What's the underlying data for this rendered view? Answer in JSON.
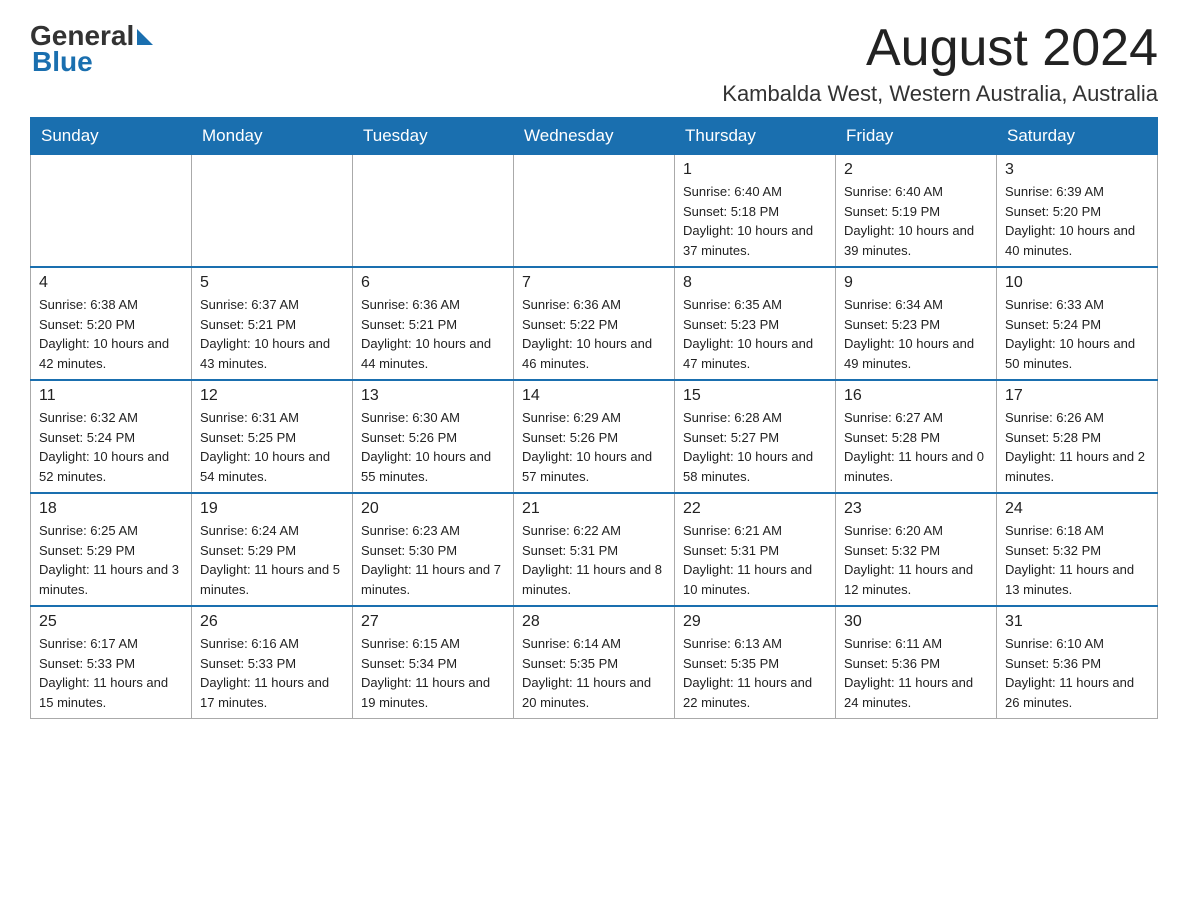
{
  "logo": {
    "general": "General",
    "triangle": "▶",
    "blue": "Blue"
  },
  "title": "August 2024",
  "subtitle": "Kambalda West, Western Australia, Australia",
  "weekdays": [
    "Sunday",
    "Monday",
    "Tuesday",
    "Wednesday",
    "Thursday",
    "Friday",
    "Saturday"
  ],
  "weeks": [
    [
      {
        "day": "",
        "info": ""
      },
      {
        "day": "",
        "info": ""
      },
      {
        "day": "",
        "info": ""
      },
      {
        "day": "",
        "info": ""
      },
      {
        "day": "1",
        "info": "Sunrise: 6:40 AM\nSunset: 5:18 PM\nDaylight: 10 hours and 37 minutes."
      },
      {
        "day": "2",
        "info": "Sunrise: 6:40 AM\nSunset: 5:19 PM\nDaylight: 10 hours and 39 minutes."
      },
      {
        "day": "3",
        "info": "Sunrise: 6:39 AM\nSunset: 5:20 PM\nDaylight: 10 hours and 40 minutes."
      }
    ],
    [
      {
        "day": "4",
        "info": "Sunrise: 6:38 AM\nSunset: 5:20 PM\nDaylight: 10 hours and 42 minutes."
      },
      {
        "day": "5",
        "info": "Sunrise: 6:37 AM\nSunset: 5:21 PM\nDaylight: 10 hours and 43 minutes."
      },
      {
        "day": "6",
        "info": "Sunrise: 6:36 AM\nSunset: 5:21 PM\nDaylight: 10 hours and 44 minutes."
      },
      {
        "day": "7",
        "info": "Sunrise: 6:36 AM\nSunset: 5:22 PM\nDaylight: 10 hours and 46 minutes."
      },
      {
        "day": "8",
        "info": "Sunrise: 6:35 AM\nSunset: 5:23 PM\nDaylight: 10 hours and 47 minutes."
      },
      {
        "day": "9",
        "info": "Sunrise: 6:34 AM\nSunset: 5:23 PM\nDaylight: 10 hours and 49 minutes."
      },
      {
        "day": "10",
        "info": "Sunrise: 6:33 AM\nSunset: 5:24 PM\nDaylight: 10 hours and 50 minutes."
      }
    ],
    [
      {
        "day": "11",
        "info": "Sunrise: 6:32 AM\nSunset: 5:24 PM\nDaylight: 10 hours and 52 minutes."
      },
      {
        "day": "12",
        "info": "Sunrise: 6:31 AM\nSunset: 5:25 PM\nDaylight: 10 hours and 54 minutes."
      },
      {
        "day": "13",
        "info": "Sunrise: 6:30 AM\nSunset: 5:26 PM\nDaylight: 10 hours and 55 minutes."
      },
      {
        "day": "14",
        "info": "Sunrise: 6:29 AM\nSunset: 5:26 PM\nDaylight: 10 hours and 57 minutes."
      },
      {
        "day": "15",
        "info": "Sunrise: 6:28 AM\nSunset: 5:27 PM\nDaylight: 10 hours and 58 minutes."
      },
      {
        "day": "16",
        "info": "Sunrise: 6:27 AM\nSunset: 5:28 PM\nDaylight: 11 hours and 0 minutes."
      },
      {
        "day": "17",
        "info": "Sunrise: 6:26 AM\nSunset: 5:28 PM\nDaylight: 11 hours and 2 minutes."
      }
    ],
    [
      {
        "day": "18",
        "info": "Sunrise: 6:25 AM\nSunset: 5:29 PM\nDaylight: 11 hours and 3 minutes."
      },
      {
        "day": "19",
        "info": "Sunrise: 6:24 AM\nSunset: 5:29 PM\nDaylight: 11 hours and 5 minutes."
      },
      {
        "day": "20",
        "info": "Sunrise: 6:23 AM\nSunset: 5:30 PM\nDaylight: 11 hours and 7 minutes."
      },
      {
        "day": "21",
        "info": "Sunrise: 6:22 AM\nSunset: 5:31 PM\nDaylight: 11 hours and 8 minutes."
      },
      {
        "day": "22",
        "info": "Sunrise: 6:21 AM\nSunset: 5:31 PM\nDaylight: 11 hours and 10 minutes."
      },
      {
        "day": "23",
        "info": "Sunrise: 6:20 AM\nSunset: 5:32 PM\nDaylight: 11 hours and 12 minutes."
      },
      {
        "day": "24",
        "info": "Sunrise: 6:18 AM\nSunset: 5:32 PM\nDaylight: 11 hours and 13 minutes."
      }
    ],
    [
      {
        "day": "25",
        "info": "Sunrise: 6:17 AM\nSunset: 5:33 PM\nDaylight: 11 hours and 15 minutes."
      },
      {
        "day": "26",
        "info": "Sunrise: 6:16 AM\nSunset: 5:33 PM\nDaylight: 11 hours and 17 minutes."
      },
      {
        "day": "27",
        "info": "Sunrise: 6:15 AM\nSunset: 5:34 PM\nDaylight: 11 hours and 19 minutes."
      },
      {
        "day": "28",
        "info": "Sunrise: 6:14 AM\nSunset: 5:35 PM\nDaylight: 11 hours and 20 minutes."
      },
      {
        "day": "29",
        "info": "Sunrise: 6:13 AM\nSunset: 5:35 PM\nDaylight: 11 hours and 22 minutes."
      },
      {
        "day": "30",
        "info": "Sunrise: 6:11 AM\nSunset: 5:36 PM\nDaylight: 11 hours and 24 minutes."
      },
      {
        "day": "31",
        "info": "Sunrise: 6:10 AM\nSunset: 5:36 PM\nDaylight: 11 hours and 26 minutes."
      }
    ]
  ]
}
